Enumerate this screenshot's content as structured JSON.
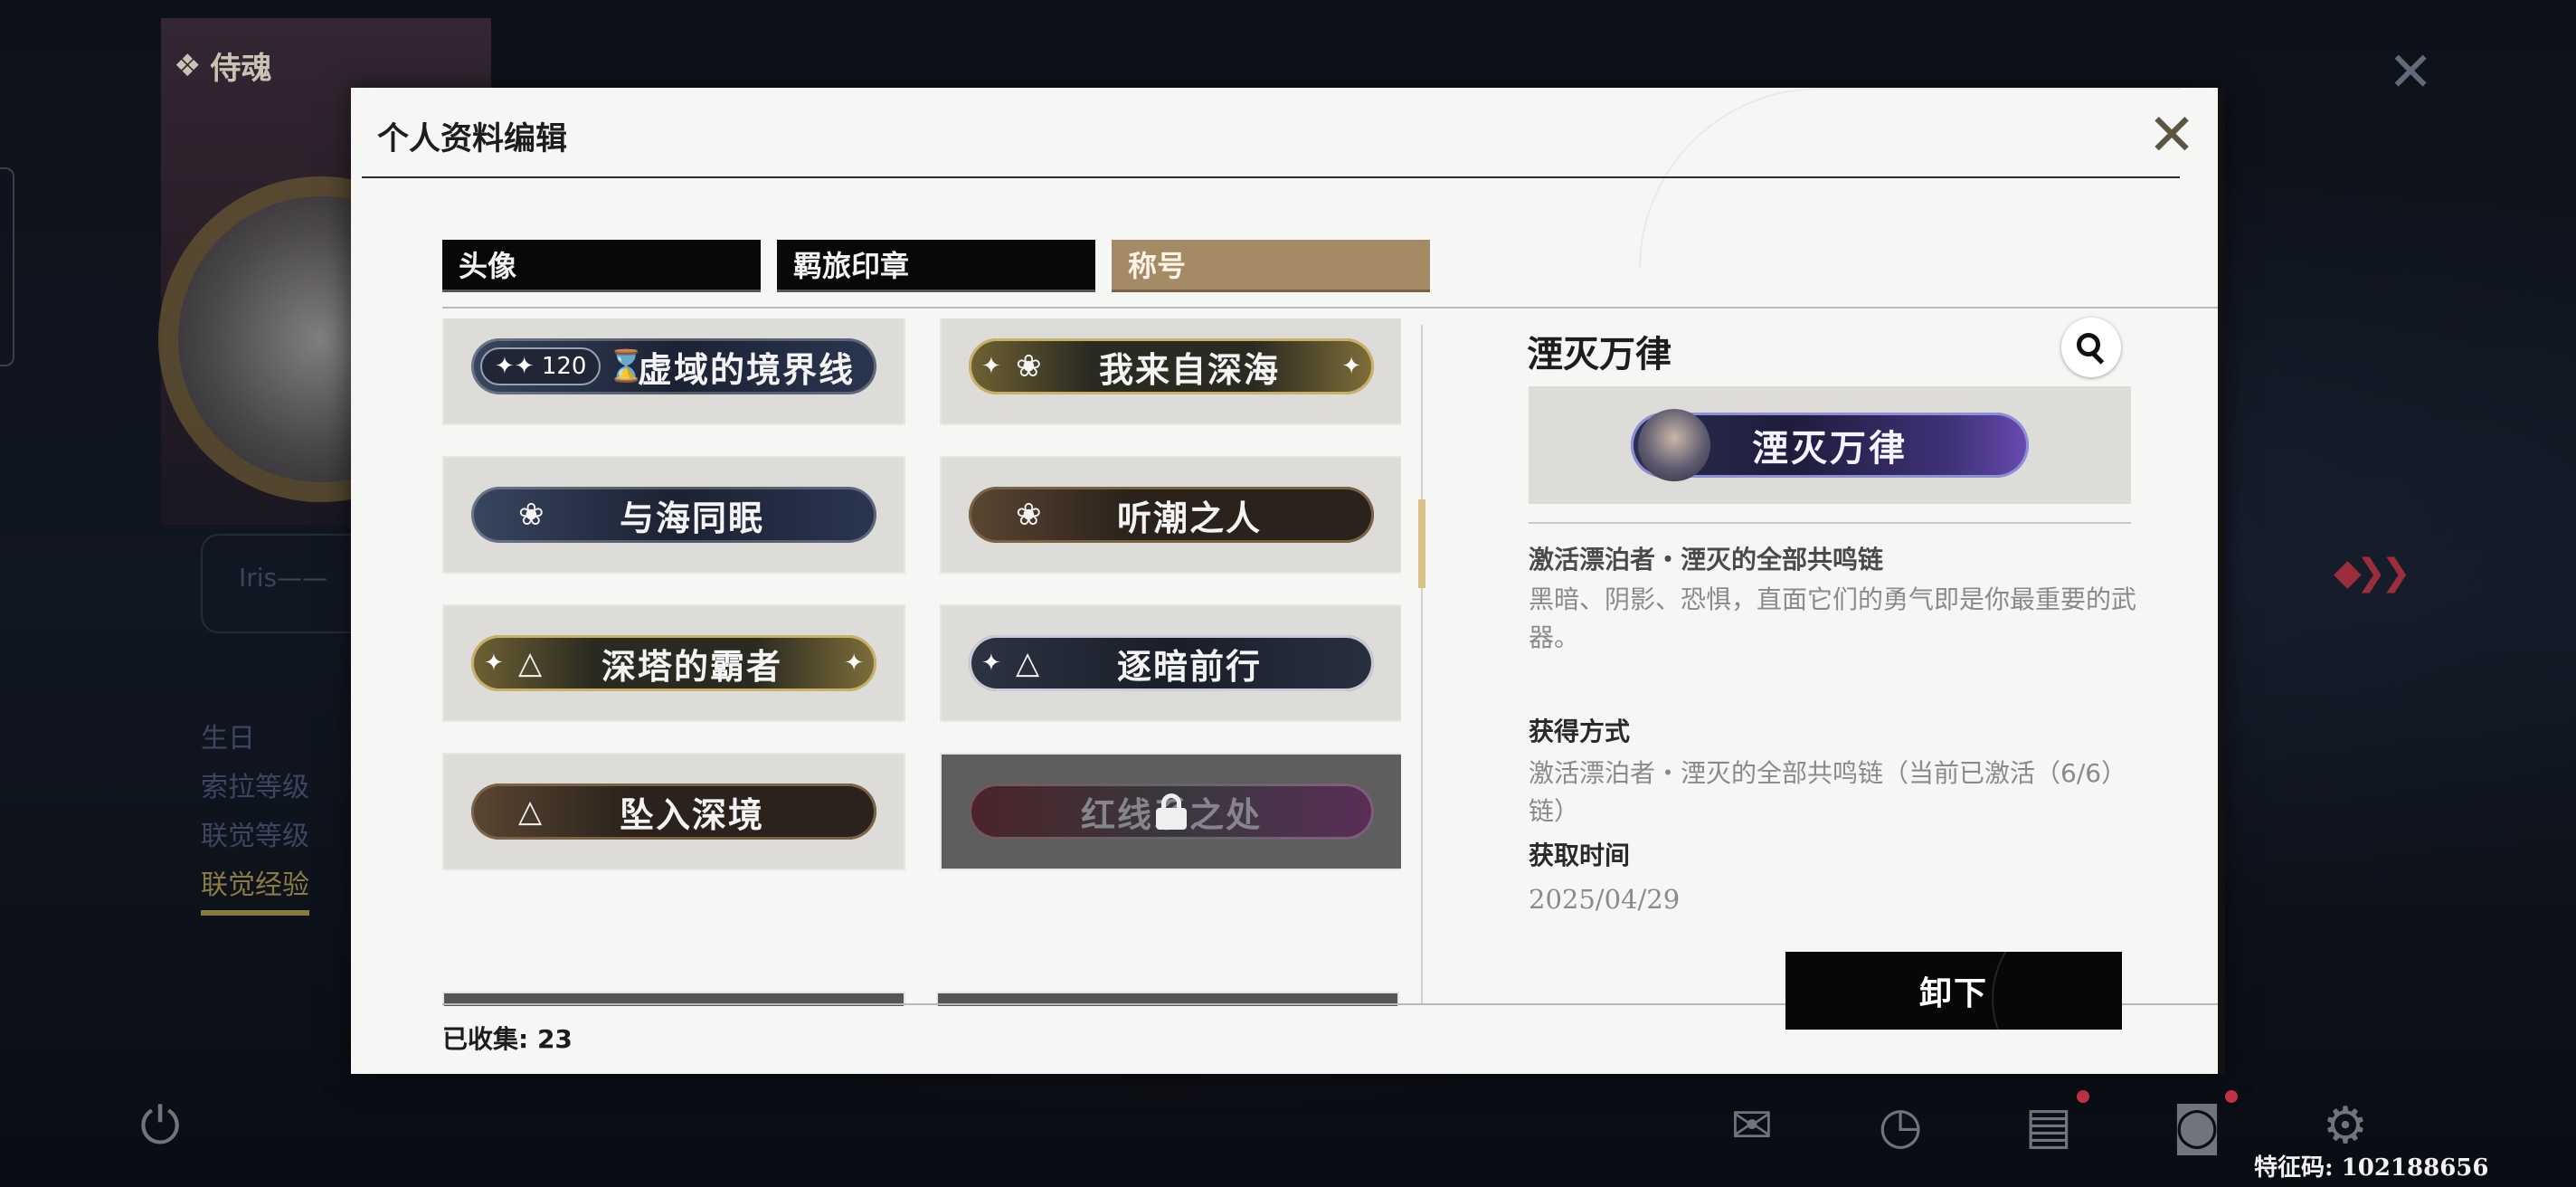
{
  "background": {
    "card_header": "侍魂",
    "input_hint": "Iris——",
    "side_items": [
      "生日",
      "索拉等级",
      "联觉等级",
      "联觉经验"
    ],
    "feature_code": "特征码: 102188656"
  },
  "modal": {
    "title": "个人资料编辑",
    "tabs": [
      {
        "label": "头像",
        "active": false
      },
      {
        "label": "羁旅印章",
        "active": false
      },
      {
        "label": "称号",
        "active": true
      }
    ],
    "titles": [
      {
        "label": "虚域的境界线",
        "style": "navy",
        "level": "120",
        "icon": "hourglass-icon"
      },
      {
        "label": "我来自深海",
        "style": "gold",
        "icon": "wave-emblem-icon"
      },
      {
        "label": "与海同眠",
        "style": "navy",
        "icon": "wave-emblem-icon"
      },
      {
        "label": "听潮之人",
        "style": "brown",
        "icon": "wave-emblem-icon"
      },
      {
        "label": "深塔的霸者",
        "style": "gold",
        "icon": "tower-icon"
      },
      {
        "label": "逐暗前行",
        "style": "navy2",
        "icon": "tower-icon"
      },
      {
        "label": "坠入深境",
        "style": "brown",
        "icon": "tower-icon"
      },
      {
        "label": "红线系之处",
        "style": "red",
        "locked": true,
        "icon": "lock-icon"
      }
    ],
    "collected_label": "已收集:",
    "collected_count": "23",
    "detail": {
      "name": "湮灭万律",
      "badge_text": "湮灭万律",
      "subtitle": "激活漂泊者・湮灭的全部共鸣链",
      "description": "黑暗、阴影、恐惧，直面它们的勇气即是你最重要的武器。",
      "method_label": "获得方式",
      "method": "激活漂泊者・湮灭的全部共鸣链（当前已激活（6/6）链）",
      "time_label": "获取时间",
      "time": "2025/04/29"
    },
    "unequip_label": "卸下"
  },
  "colors": {
    "active_tab": "#a58a66",
    "scroll_thumb": "#d9c28a",
    "locked_cell": "#5e5e5e",
    "button_bg": "#070707"
  }
}
